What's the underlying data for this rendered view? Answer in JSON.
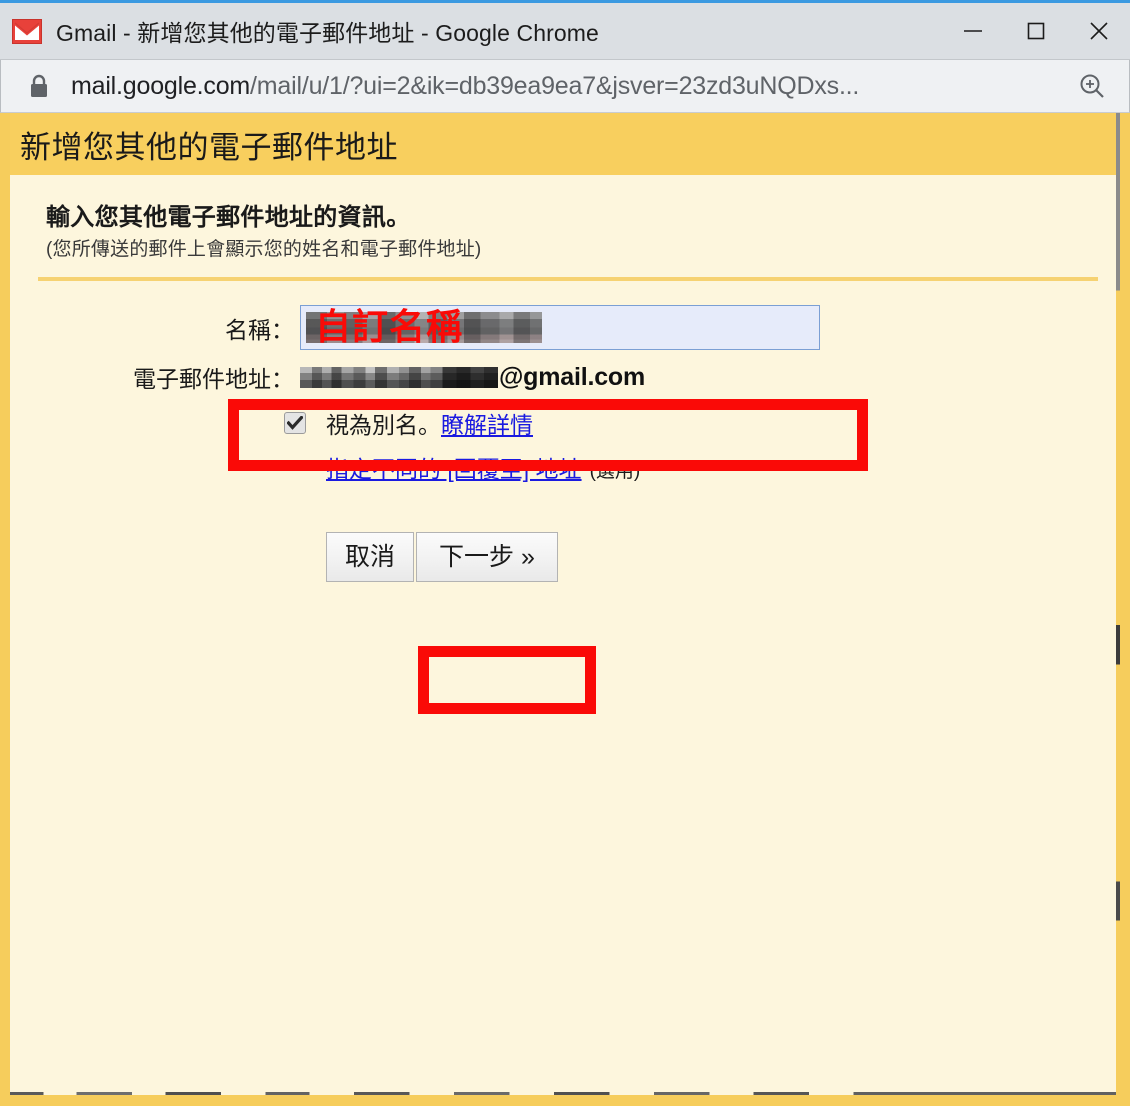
{
  "window": {
    "title": "Gmail - 新增您其他的電子郵件地址 - Google Chrome",
    "favicon": "gmail-envelope-icon",
    "minimize_label": "minimize-icon",
    "maximize_label": "maximize-icon",
    "close_label": "close-icon"
  },
  "omnibox": {
    "lock_icon": "lock-icon",
    "url_host": "mail.google.com",
    "url_path": "/mail/u/1/?ui=2&ik=db39ea9ea7&jsver=23zd3uNQDxs...",
    "zoom_icon": "zoom-in-icon"
  },
  "banner": {
    "title": "新增您其他的電子郵件地址"
  },
  "intro": {
    "heading": "輸入您其他電子郵件地址的資訊。",
    "subtext": "(您所傳送的郵件上會顯示您的姓名和電子郵件地址)"
  },
  "form": {
    "name_label": "名稱：",
    "name_value": "",
    "name_placeholder": "",
    "name_annotation_text": "自訂名稱",
    "email_label": "電子郵件地址：",
    "email_domain": "@gmail.com",
    "alias_checkbox_checked": true,
    "alias_label": "視為別名。",
    "alias_link": "瞭解詳情",
    "replyto_link": "指定不同的 [回覆至] 地址",
    "replyto_optional": "(選用)"
  },
  "buttons": {
    "cancel": "取消",
    "next": "下一步 »"
  },
  "colors": {
    "banner": "#f8cf5e",
    "page_background": "#fdf6dd",
    "border_gold": "#f6cd5c",
    "annotation_red": "#fa0a07",
    "link_blue": "#1a1ae0",
    "input_background": "#e6ebfa",
    "input_border": "#7b9fd4",
    "titlebar": "#dbdfe3",
    "omnibox": "#eff1f3",
    "chrome_accent": "#3b9ae1"
  }
}
